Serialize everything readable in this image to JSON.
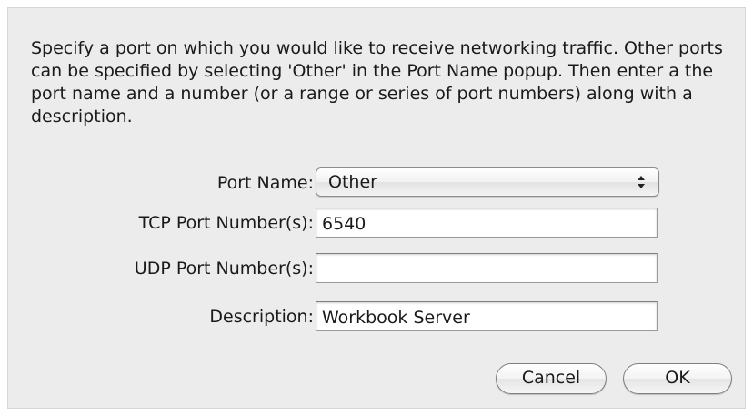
{
  "dialog": {
    "description": "Specify a port on which you would like to receive networking traffic. Other ports can be specified by selecting 'Other' in the Port Name popup. Then enter a the port name and a number (or a range or series of port numbers) along with a description."
  },
  "form": {
    "port_name": {
      "label": "Port Name:",
      "selected": "Other"
    },
    "tcp": {
      "label": "TCP Port Number(s):",
      "value": "6540",
      "placeholder": ""
    },
    "udp": {
      "label": "UDP Port Number(s):",
      "value": "",
      "placeholder": ""
    },
    "description": {
      "label": "Description:",
      "value": "Workbook Server",
      "placeholder": ""
    }
  },
  "buttons": {
    "cancel": "Cancel",
    "ok": "OK"
  },
  "icons": {
    "popup_arrows": "up-down-chevron-icon"
  }
}
